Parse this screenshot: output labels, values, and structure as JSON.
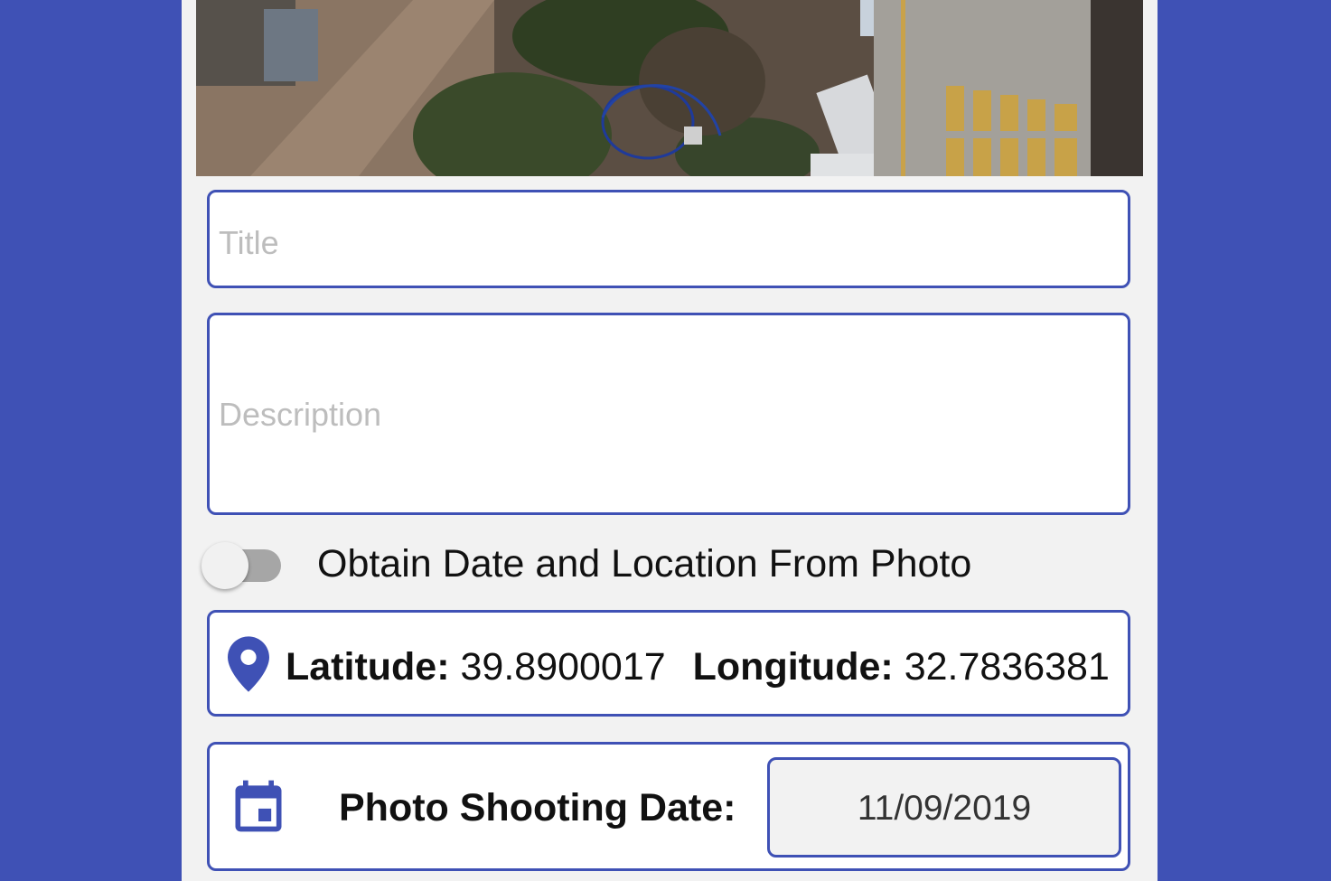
{
  "colors": {
    "primary": "#3f51b5",
    "panel_background": "#f2f2f2",
    "placeholder": "#bdbdbd",
    "switch_track_off": "#a6a6a6"
  },
  "photo": {
    "alt": "aerial-photo-preview"
  },
  "form": {
    "title_placeholder": "Title",
    "title_value": "",
    "description_placeholder": "Description",
    "description_value": ""
  },
  "toggle": {
    "label": "Obtain Date and Location From Photo",
    "checked": false
  },
  "location": {
    "icon": "location-pin-icon",
    "latitude_label": "Latitude:",
    "latitude_value": "39.8900017",
    "longitude_label": "Longitude:",
    "longitude_value": "32.7836381"
  },
  "shooting_date": {
    "icon": "calendar-icon",
    "label": "Photo Shooting Date:",
    "value": "11/09/2019"
  }
}
